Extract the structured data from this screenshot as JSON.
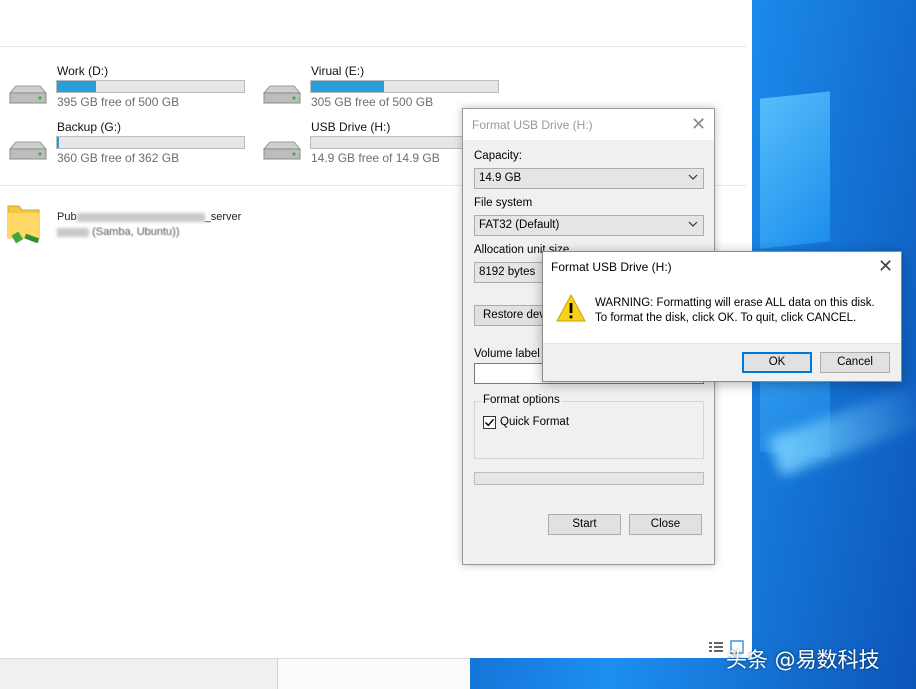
{
  "explorer": {
    "drives": [
      {
        "name": "Work (D:)",
        "free_text": "395 GB free of 500 GB",
        "used_fraction": 0.21
      },
      {
        "name": "Virual (E:)",
        "free_text": "305 GB free of 500 GB",
        "used_fraction": 0.39
      },
      {
        "name": "Backup (G:)",
        "free_text": "360 GB free of 362 GB",
        "used_fraction": 0.01
      },
      {
        "name": "USB Drive (H:)",
        "free_text": "14.9 GB free of 14.9 GB",
        "used_fraction": 0.0
      }
    ],
    "network_location": {
      "line1_prefix": "Pub",
      "line1_suffix": "_server",
      "line2_suffix": "(Samba, Ubuntu))"
    }
  },
  "format_dialog": {
    "title": "Format USB Drive (H:)",
    "capacity_label": "Capacity:",
    "capacity_value": "14.9 GB",
    "filesystem_label": "File system",
    "filesystem_value": "FAT32 (Default)",
    "allocation_label": "Allocation unit size",
    "allocation_value": "8192 bytes",
    "restore_button": "Restore device defaults",
    "volume_label": "Volume label",
    "volume_value": "",
    "format_options_label": "Format options",
    "quick_format_label": "Quick Format",
    "quick_format_checked": true,
    "start_button": "Start",
    "close_button": "Close"
  },
  "warning_dialog": {
    "title": "Format USB Drive (H:)",
    "line1": "WARNING: Formatting will erase ALL data on this disk.",
    "line2": "To format the disk, click OK. To quit, click CANCEL.",
    "ok_button": "OK",
    "cancel_button": "Cancel",
    "icon": "warning-icon"
  },
  "watermark": {
    "text": "头条 @易数科技"
  },
  "colors": {
    "drive_fill": "#26a0da",
    "ok_border": "#0078d7",
    "warning_yellow": "#f7d21b"
  }
}
